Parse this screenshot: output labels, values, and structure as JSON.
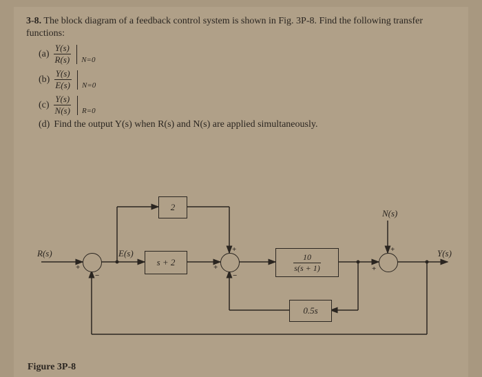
{
  "problem": {
    "number": "3-8.",
    "prompt": "The block diagram of a feedback control system is shown in Fig. 3P-8. Find the following transfer functions:",
    "parts": {
      "a": {
        "label": "(a)",
        "num": "Y(s)",
        "den": "R(s)",
        "cond": "N=0"
      },
      "b": {
        "label": "(b)",
        "num": "Y(s)",
        "den": "E(s)",
        "cond": "N=0"
      },
      "c": {
        "label": "(c)",
        "num": "Y(s)",
        "den": "N(s)",
        "cond": "R=0"
      },
      "d": {
        "label": "(d)",
        "text": "Find the output Y(s) when R(s) and N(s) are applied simultaneously."
      }
    }
  },
  "diagram": {
    "signals": {
      "R": "R(s)",
      "E": "E(s)",
      "N": "N(s)",
      "Y": "Y(s)"
    },
    "blocks": {
      "feedforward": "2",
      "controller": "s + 2",
      "plant_num": "10",
      "plant_den": "s(s + 1)",
      "feedback": "0.5s"
    },
    "signs": {
      "sum1_left": "+",
      "sum1_bottom": "−",
      "sum2_top": "+",
      "sum2_left": "+",
      "sum2_bottom": "−",
      "sum3_top": "+",
      "sum3_left": "+"
    }
  },
  "figure_caption": "Figure 3P-8"
}
